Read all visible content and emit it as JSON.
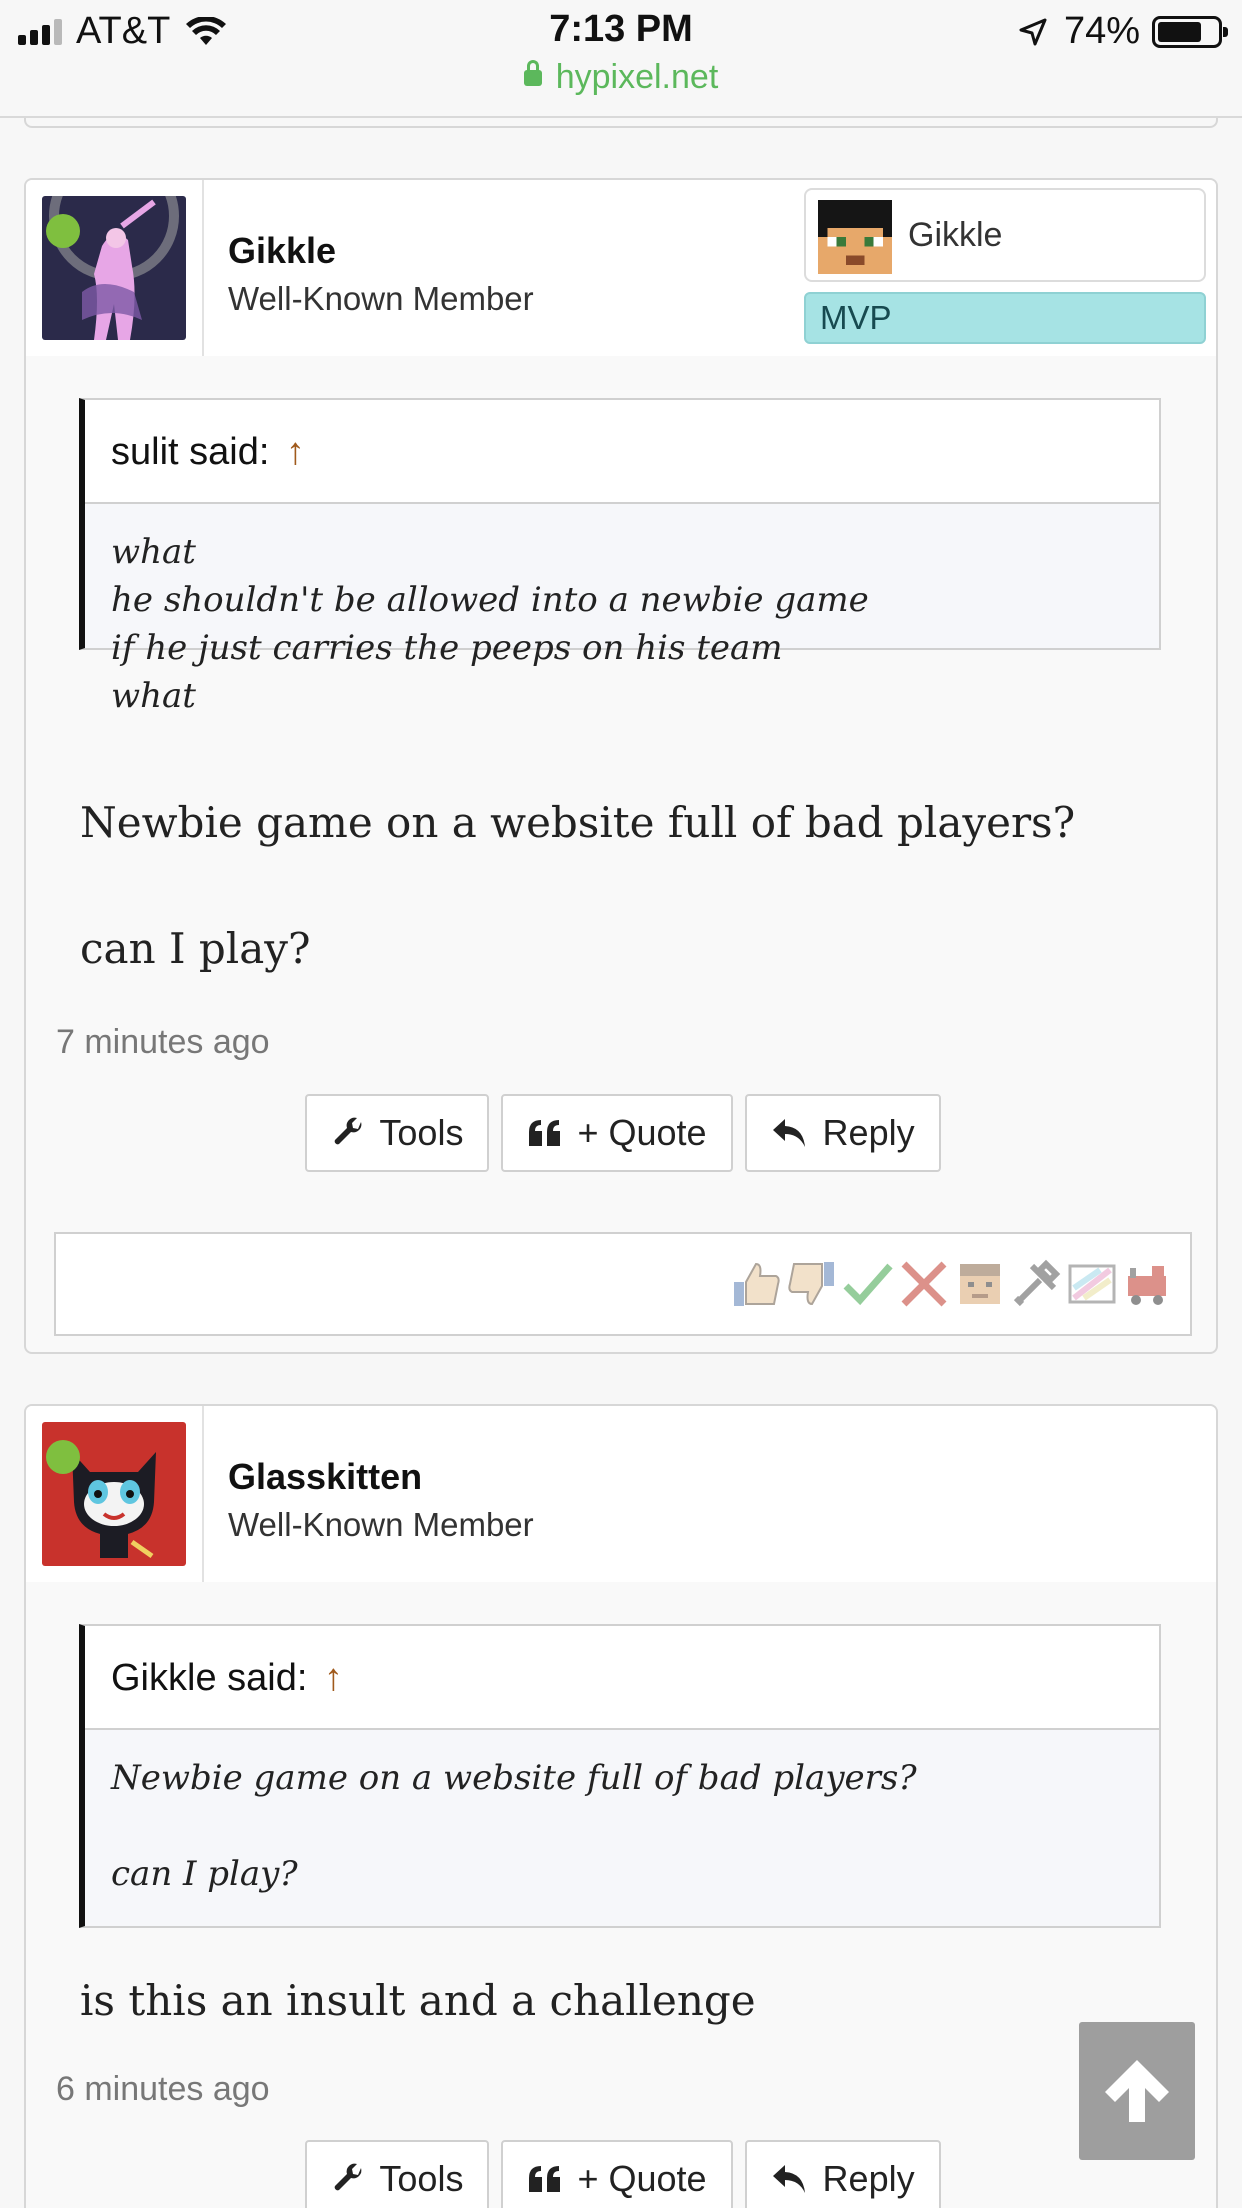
{
  "status_bar": {
    "carrier": "AT&T",
    "time": "7:13 PM",
    "battery": "74%",
    "url": "hypixel.net"
  },
  "posts": [
    {
      "username": "Gikkle",
      "user_title": "Well-Known Member",
      "rank_name": "Gikkle",
      "rank": "MVP",
      "quote_author": "sulit said:",
      "quote_arrow": "↑",
      "quote_lines": [
        "what",
        "he shouldn't be allowed into a newbie game",
        "if he just carries the peeps on his team",
        "what"
      ],
      "message_lines": [
        "Newbie game on a website full of bad players?",
        "can I play?"
      ],
      "time": "7 minutes ago",
      "actions": {
        "tools": "Tools",
        "quote": "+ Quote",
        "reply": "Reply"
      },
      "ratings": [
        "like-icon",
        "dislike-icon",
        "agree-icon",
        "disagree-icon",
        "funny-icon",
        "useful-icon",
        "creative-icon",
        "train-icon"
      ]
    },
    {
      "username": "Glasskitten",
      "user_title": "Well-Known Member",
      "quote_author": "Gikkle said:",
      "quote_arrow": "↑",
      "quote_lines": [
        "Newbie game on a website full of bad players?",
        "",
        "can I play?"
      ],
      "message_lines": [
        "is this an insult and a challenge"
      ],
      "time": "6 minutes ago",
      "actions": {
        "tools": "Tools",
        "quote": "+ Quote",
        "reply": "Reply"
      }
    }
  ],
  "colors": {
    "url_green": "#5cb85c",
    "mvp_badge": "#a6e3e4",
    "online": "#7fbf3f",
    "quote_arrow": "#a05a1c"
  }
}
